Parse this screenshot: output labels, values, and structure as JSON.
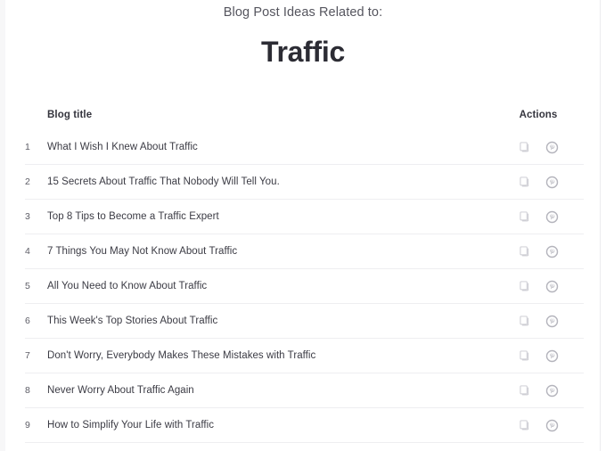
{
  "heading": {
    "subtitle": "Blog Post Ideas Related to:",
    "keyword": "Traffic"
  },
  "table": {
    "columns": {
      "number": "",
      "title": "Blog title",
      "actions": "Actions"
    },
    "rows": [
      {
        "num": "1",
        "title": "What I Wish I Knew About Traffic"
      },
      {
        "num": "2",
        "title": "15 Secrets About Traffic That Nobody Will Tell You."
      },
      {
        "num": "3",
        "title": "Top 8 Tips to Become a Traffic Expert"
      },
      {
        "num": "4",
        "title": "7 Things You May Not Know About Traffic"
      },
      {
        "num": "5",
        "title": "All You Need to Know About Traffic"
      },
      {
        "num": "6",
        "title": "This Week's Top Stories About Traffic"
      },
      {
        "num": "7",
        "title": "Don't Worry, Everybody Makes These Mistakes with Traffic"
      },
      {
        "num": "8",
        "title": "Never Worry About Traffic Again"
      },
      {
        "num": "9",
        "title": "How to Simplify Your Life with Traffic"
      }
    ],
    "row_actions": {
      "copy_icon": "copy-icon",
      "pin_icon": "pinterest-save-icon"
    }
  },
  "colors": {
    "title_text": "#2c2c34",
    "subtitle_text": "#55555e",
    "body_text": "#3b3b44",
    "row_divider": "#eeeef1",
    "icon_muted": "#c0c0c8",
    "page_background": "#ffffff"
  }
}
